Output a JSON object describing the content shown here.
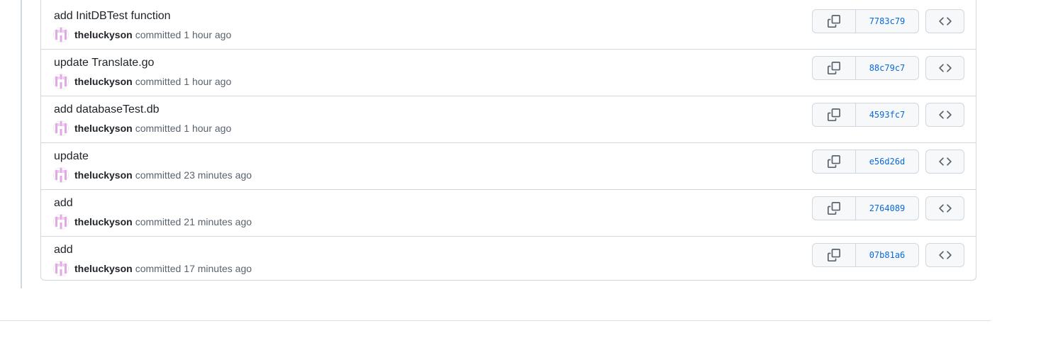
{
  "colors": {
    "accent": "#0969da",
    "border": "#d0d7de",
    "muted_text": "#59636e",
    "avatar_pink": "#e3a8e3"
  },
  "commits": [
    {
      "title": "add InitDBTest function",
      "author": "theluckyson",
      "action": "committed",
      "time": "1 hour ago",
      "sha": "7783c79",
      "copy_icon": "copy-icon",
      "browse_icon": "code-icon"
    },
    {
      "title": "update Translate.go",
      "author": "theluckyson",
      "action": "committed",
      "time": "1 hour ago",
      "sha": "88c79c7",
      "copy_icon": "copy-icon",
      "browse_icon": "code-icon"
    },
    {
      "title": "add databaseTest.db",
      "author": "theluckyson",
      "action": "committed",
      "time": "1 hour ago",
      "sha": "4593fc7",
      "copy_icon": "copy-icon",
      "browse_icon": "code-icon"
    },
    {
      "title": "update",
      "author": "theluckyson",
      "action": "committed",
      "time": "23 minutes ago",
      "sha": "e56d26d",
      "copy_icon": "copy-icon",
      "browse_icon": "code-icon"
    },
    {
      "title": "add",
      "author": "theluckyson",
      "action": "committed",
      "time": "21 minutes ago",
      "sha": "2764089",
      "copy_icon": "copy-icon",
      "browse_icon": "code-icon"
    },
    {
      "title": "add",
      "author": "theluckyson",
      "action": "committed",
      "time": "17 minutes ago",
      "sha": "07b81a6",
      "copy_icon": "copy-icon",
      "browse_icon": "code-icon"
    }
  ]
}
